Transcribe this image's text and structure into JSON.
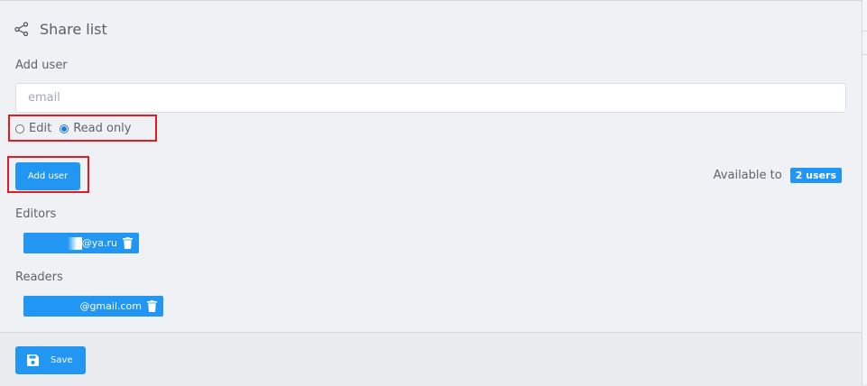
{
  "header": {
    "title": "Share list",
    "icon": "share-icon"
  },
  "form": {
    "add_user_label": "Add user",
    "email_placeholder": "email",
    "email_value": "",
    "permission_options": [
      {
        "label": "Edit",
        "selected": false
      },
      {
        "label": "Read only",
        "selected": true
      }
    ],
    "add_user_button": "Add user"
  },
  "availability": {
    "label": "Available to",
    "badge": "2 users"
  },
  "editors": {
    "label": "Editors",
    "users": [
      {
        "email": "@ya.ru"
      }
    ]
  },
  "readers": {
    "label": "Readers",
    "users": [
      {
        "email": "@gmail.com"
      }
    ]
  },
  "footer": {
    "save_label": "Save",
    "save_icon": "floppy-disk-icon"
  },
  "colors": {
    "accent": "#2196f3",
    "highlight": "#e31b23",
    "panel_bg": "#eff1f5"
  }
}
